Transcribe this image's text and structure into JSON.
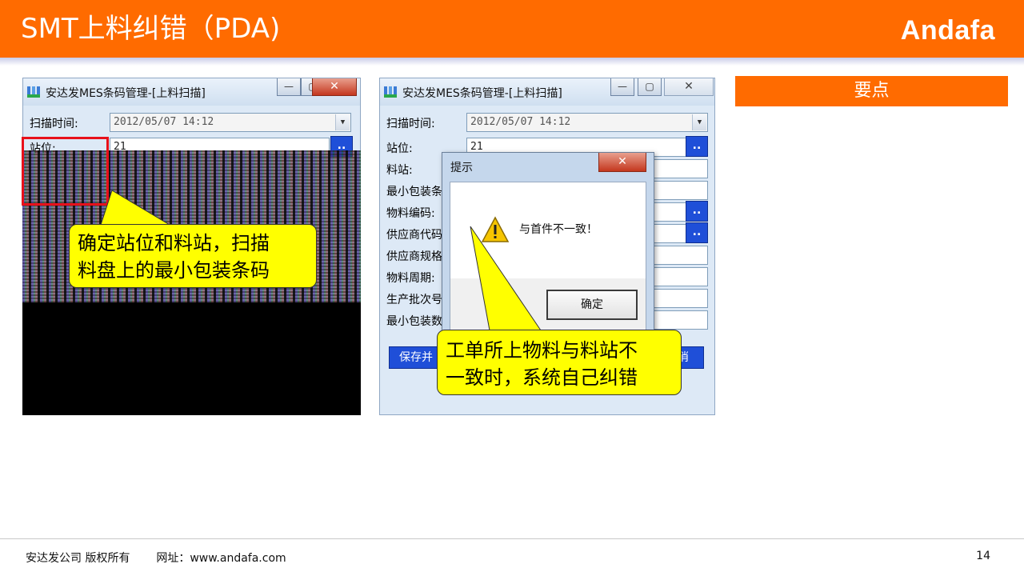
{
  "header": {
    "title": "SMT上料纠错（PDA)",
    "brand": "Andafa"
  },
  "keypoints_label": "要点",
  "left_window": {
    "title": "安达发MES条码管理-[上料扫描]",
    "scan_time_label": "扫描时间:",
    "scan_time_value": "2012/05/07  14:12",
    "station_label": "站位:",
    "station_value": "21",
    "ellipsis_label": ".."
  },
  "right_window": {
    "title": "安达发MES条码管理-[上料扫描]",
    "scan_time_label": "扫描时间:",
    "scan_time_value": "2012/05/07  14:12",
    "station_label": "站位:",
    "station_value": "21",
    "fields": [
      "料站:",
      "最小包装条",
      "物料编码:",
      "供应商代码",
      "供应商规格",
      "物料周期:",
      "生产批次号",
      "最小包装数"
    ],
    "ellipsis_label": "..",
    "save_button": "保存并",
    "cancel_button": "消"
  },
  "dialog": {
    "title": "提示",
    "message": "与首件不一致！",
    "ok_button": "确定"
  },
  "callouts": {
    "left_line1": "确定站位和料站，扫描",
    "left_line2": "料盘上的最小包装条码",
    "right_line1": "工单所上物料与料站不",
    "right_line2": "一致时，系统自己纠错"
  },
  "footer": {
    "copyright": "安达发公司 版权所有",
    "website": "网址：www.andafa.com",
    "page_number": "14"
  }
}
